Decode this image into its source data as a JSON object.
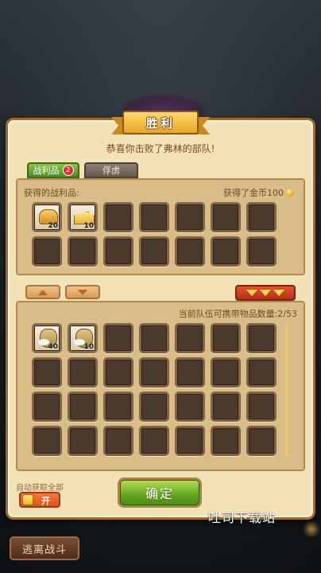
{
  "header": {
    "title": "胜利",
    "subtitle": "恭喜你击败了弗林的部队!"
  },
  "tabs": [
    {
      "label": "战利品",
      "badge": "2",
      "active": true
    },
    {
      "label": "俘虏",
      "active": false
    }
  ],
  "loot_panel": {
    "label": "获得的战利品:",
    "gold_text": "获得了金币100",
    "items": [
      {
        "icon": "bread-icon",
        "qty": "20"
      },
      {
        "icon": "cheese-icon",
        "qty": "10"
      }
    ]
  },
  "inventory_panel": {
    "capacity_text": "当前队伍可携带物品数量:2/53",
    "items": [
      {
        "icon": "flour-sack-icon",
        "qty": "40"
      },
      {
        "icon": "flour-sack-icon",
        "qty": "10"
      }
    ]
  },
  "auto_collect": {
    "label": "自动获取全部",
    "toggle_text": "开"
  },
  "buttons": {
    "confirm": "确定",
    "escape": "逃离战斗"
  },
  "watermark": "吐司下载站",
  "colors": {
    "accent_gold": "#e7a52a",
    "confirm_green": "#64a322",
    "toggle_orange": "#d55420"
  }
}
